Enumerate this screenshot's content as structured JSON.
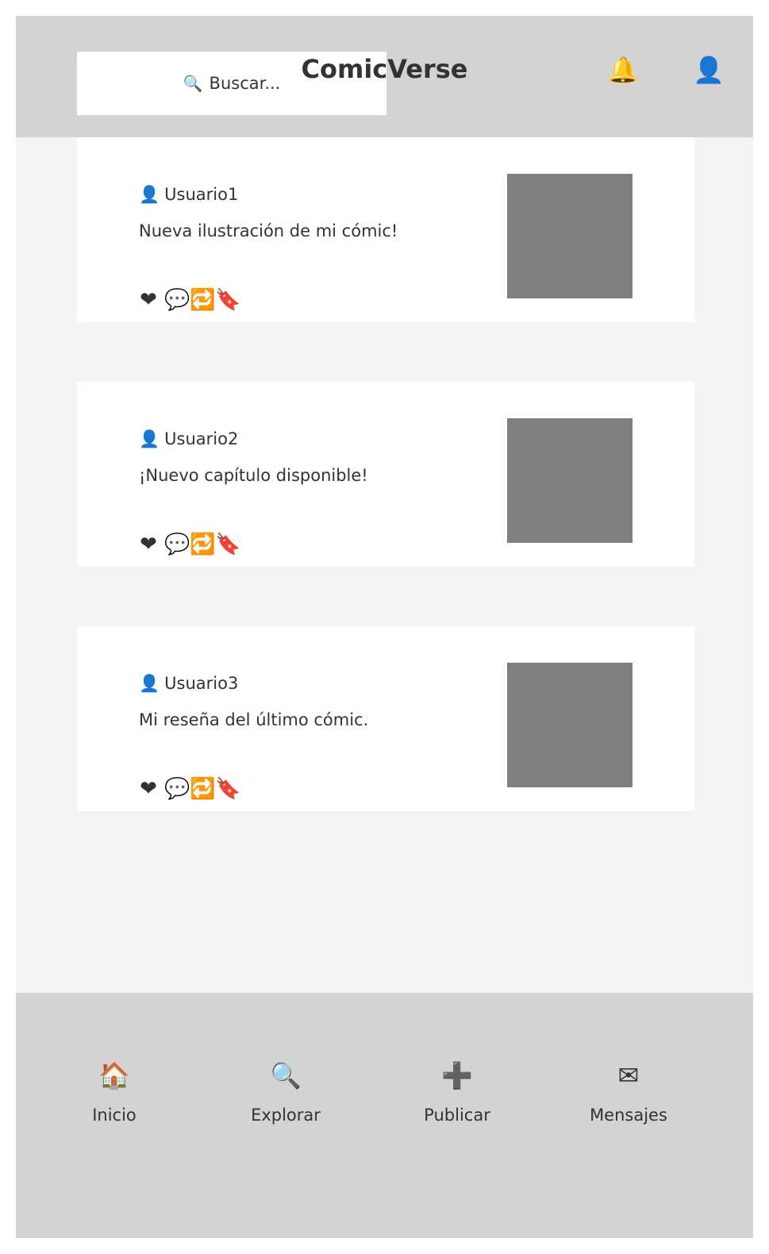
{
  "header": {
    "title": "ComicVerse",
    "search": {
      "icon": "🔍",
      "placeholder": "Buscar..."
    },
    "icons": [
      {
        "name": "notifications-icon",
        "glyph": "🔔"
      },
      {
        "name": "profile-icon",
        "glyph": "👤"
      }
    ]
  },
  "feed": {
    "posts": [
      {
        "user_icon": "👤",
        "username": "Usuario1",
        "text": "Nueva ilustración de mi cómic!",
        "actions": {
          "like": "❤",
          "comment": "💬",
          "share": "🔁",
          "save": "🔖"
        }
      },
      {
        "user_icon": "👤",
        "username": "Usuario2",
        "text": "¡Nuevo capítulo disponible!",
        "actions": {
          "like": "❤",
          "comment": "💬",
          "share": "🔁",
          "save": "🔖"
        }
      },
      {
        "user_icon": "👤",
        "username": "Usuario3",
        "text": "Mi reseña del último cómic.",
        "actions": {
          "like": "❤",
          "comment": "💬",
          "share": "🔁",
          "save": "🔖"
        }
      }
    ]
  },
  "bottom_nav": {
    "items": [
      {
        "icon": "🏠",
        "label": "Inicio"
      },
      {
        "icon": "🔍",
        "label": "Explorar"
      },
      {
        "icon": "➕",
        "label": "Publicar"
      },
      {
        "icon": "✉",
        "label": "Mensajes"
      }
    ]
  },
  "colors": {
    "header_bg": "#d3d3d3",
    "page_bg": "#f4f4f4",
    "card_bg": "#ffffff",
    "thumbnail": "#808080",
    "text": "#333333"
  }
}
